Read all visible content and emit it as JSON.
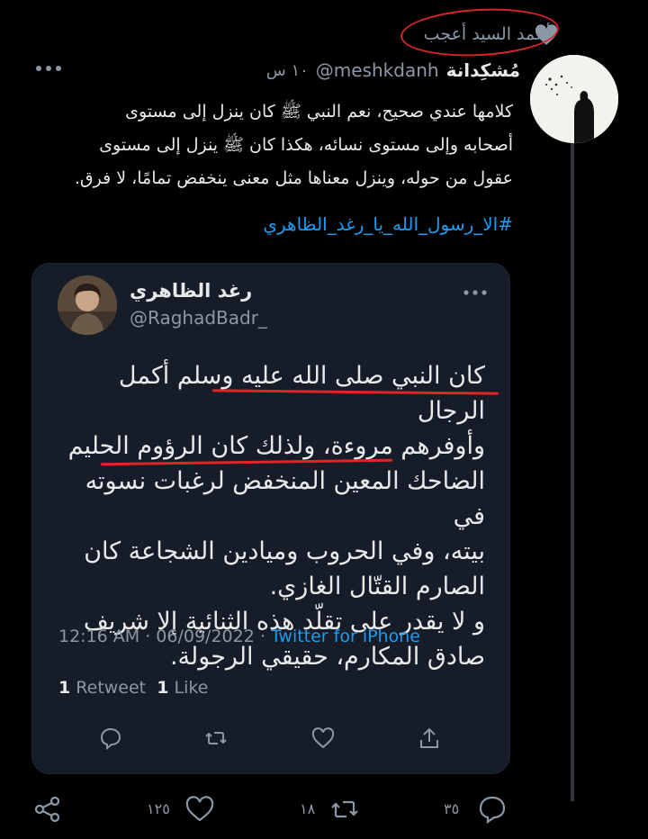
{
  "liked_by": {
    "name": "أحمد السيد أعجب"
  },
  "tweet": {
    "author_name": "مُشكِدانة",
    "author_handle": "@meshkdanh",
    "time": "١٠ س",
    "text_lines": [
      "كلامها عندي صحيح، نعم النبي ﷺ كان ينزل إلى مستوى",
      "أصحابه وإلى مستوى نسائه، هكذا كان ﷺ ينزل إلى مستوى",
      "عقول من حوله، وينزل معناها مثل معنى ينخفض تمامًا، لا فرق."
    ],
    "hashtag": "#الا_رسول_الله_يا_رغد_الظاهري"
  },
  "quoted": {
    "name": "رغد الظاهري",
    "handle": "@RaghadBadr_",
    "lines": [
      "كان النبي صلى الله عليه وسلم أكمل الرجال",
      "وأوفرهم مروءة، ولذلك كان الرؤوم الحليم",
      "الضاحك المعين المنخفض لرغبات نسوته في",
      "بيته، وفي الحروب وميادين الشجاعة كان",
      "الصارم القتّال الغازي.",
      "و لا يقدر على تقلّد هذه الثنائية إلا شريف",
      "صادق المكارم، حقيقي الرجولة."
    ],
    "timestamp": "12:16 AM · 06/09/2022 · ",
    "source": "Twitter for iPhone",
    "retweets_count": "1",
    "retweets_label": "Retweet",
    "likes_count": "1",
    "likes_label": "Like"
  },
  "actions": {
    "replies": "٣٥",
    "retweets": "١٨",
    "likes": "١٢٥"
  },
  "colors": {
    "background": "#000000",
    "card": "#161c28",
    "link": "#1d9bf0",
    "muted": "#8b98a5",
    "highlight": "#e2242a"
  }
}
